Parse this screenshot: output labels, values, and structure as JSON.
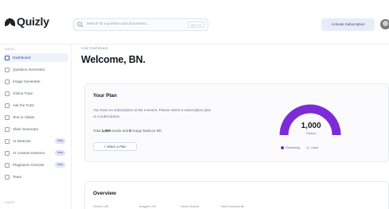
{
  "app": {
    "logo_text": "Quizly"
  },
  "topbar": {
    "search_placeholder": "Search for a question and documents...",
    "search_shortcut": "Ctrl + K",
    "upgrade_label": "Activate Subscription"
  },
  "sidebar": {
    "section_main": "MENU",
    "items": [
      {
        "label": "Dashboard",
        "icon": "grid-icon",
        "active": true
      },
      {
        "label": "Question Generator",
        "icon": "file-icon"
      },
      {
        "label": "Image Generator",
        "icon": "image-icon"
      },
      {
        "label": "Online Tutor",
        "icon": "chat-icon"
      },
      {
        "label": "Ask the Tutor",
        "icon": "question-icon"
      },
      {
        "label": "Text to Slides",
        "icon": "slides-icon"
      },
      {
        "label": "Slide Generator",
        "icon": "presentation-icon"
      },
      {
        "label": "AI Detector",
        "icon": "sparkle-icon",
        "badge": "New"
      },
      {
        "label": "AI Content Detector",
        "icon": "scan-icon",
        "badge": "New"
      },
      {
        "label": "Plagiarism Checker",
        "icon": "list-icon",
        "badge": "New"
      },
      {
        "label": "Team",
        "icon": "team-icon"
      }
    ],
    "section_bottom": "USER"
  },
  "main": {
    "breadcrumb": "User Dashboard",
    "welcome": "Welcome, BN.",
    "plan": {
      "title": "Your Plan",
      "description": "You have no subscription at the moment. Please select a subscription plan or a subscription.",
      "usage_prefix": "Total ",
      "words": "1,000",
      "usage_middle": " words and ",
      "images": "5",
      "usage_suffix": " image balance left.",
      "button_label": "+ Select a Plan",
      "gauge_value": "1,000",
      "gauge_caption": "Tokens",
      "gauge_fraction": 1.0,
      "legend": [
        {
          "label": "Remaining",
          "color": "#7b2cd6"
        },
        {
          "label": "Used",
          "color": "#d9dce5"
        }
      ],
      "accent_color": "#7b2cd6"
    },
    "overview": {
      "title": "Overview",
      "columns": [
        "Words Left",
        "Images Left",
        "Hours Saved",
        "Total Documents"
      ]
    }
  }
}
